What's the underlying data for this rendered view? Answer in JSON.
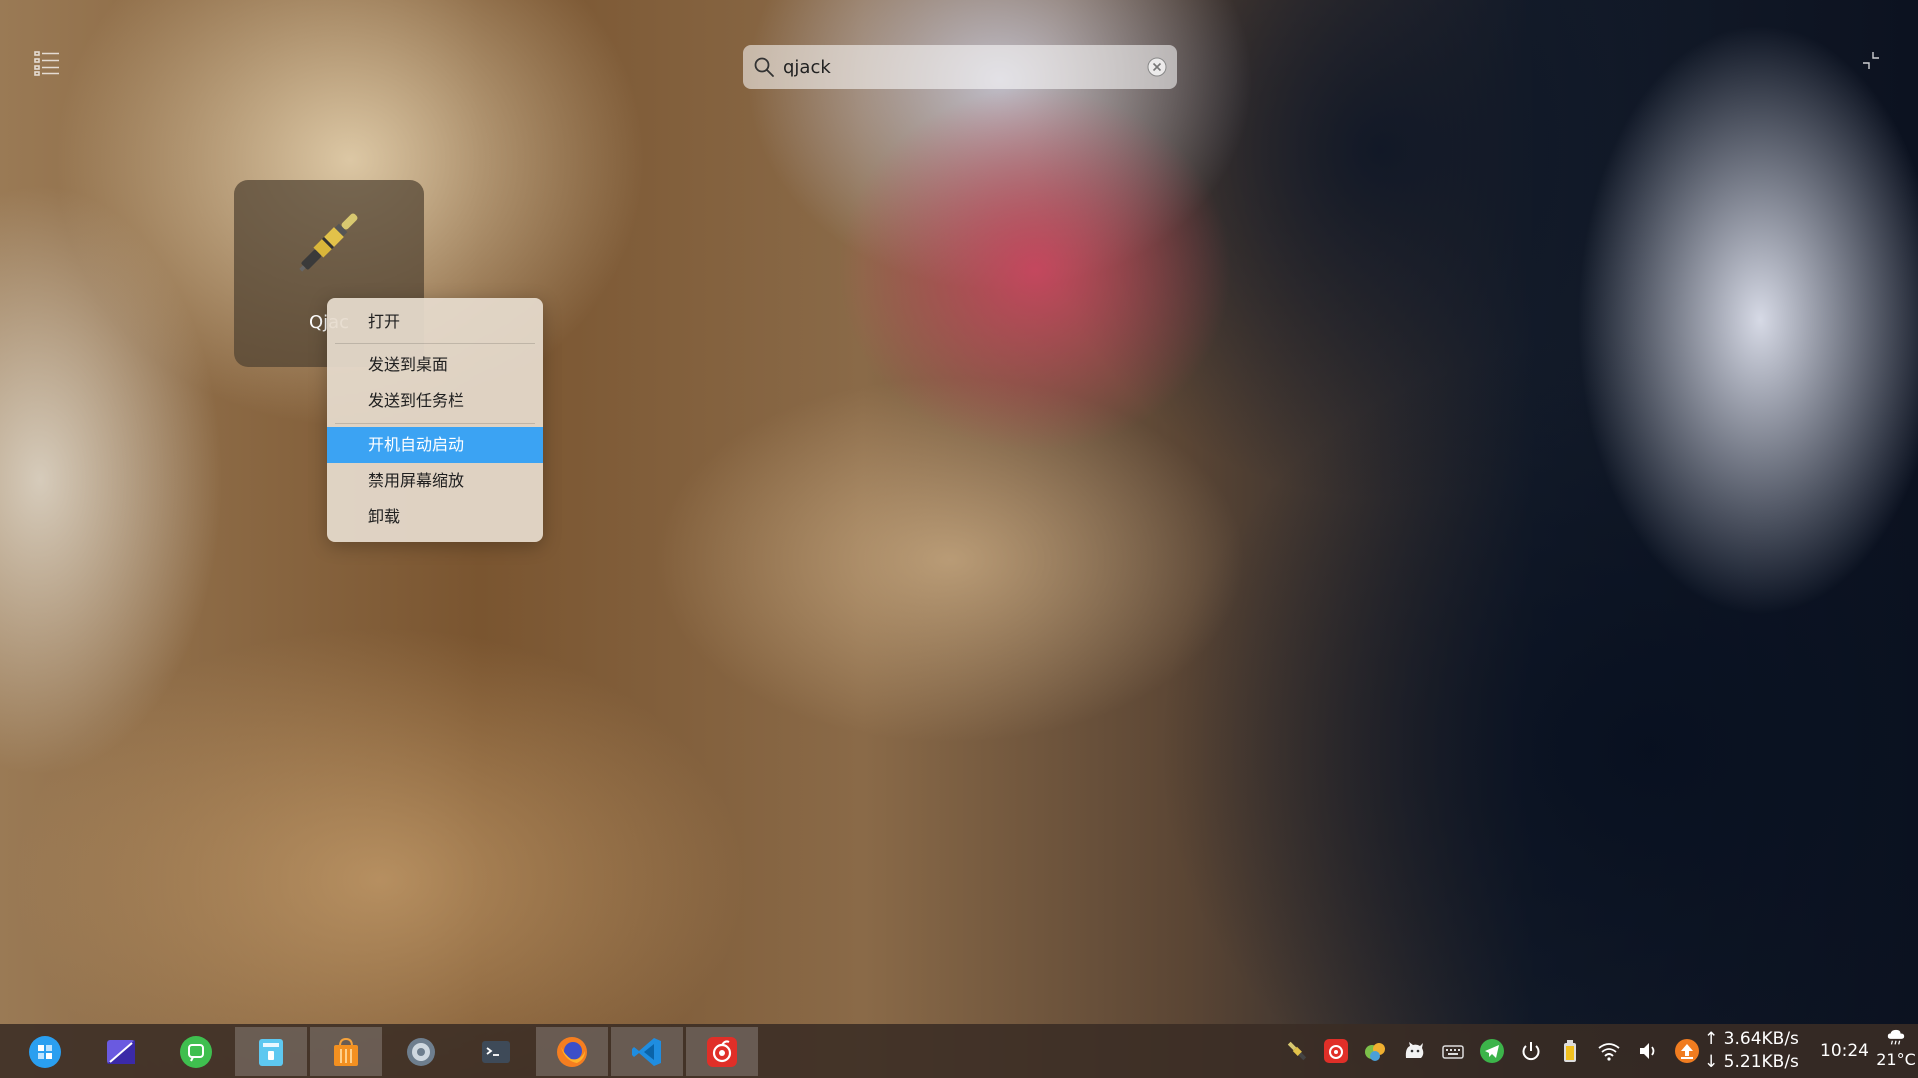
{
  "search": {
    "value": "qjack"
  },
  "result": {
    "label": "Qjac",
    "icon": "audio-jack-icon"
  },
  "context_menu": {
    "items": [
      {
        "label": "打开"
      },
      {
        "label": "发送到桌面"
      },
      {
        "label": "发送到任务栏"
      },
      {
        "label": "开机自动启动",
        "highlighted": true
      },
      {
        "label": "禁用屏幕缩放"
      },
      {
        "label": "卸载"
      }
    ],
    "highlight_color": "#3ba3f3"
  },
  "taskbar": {
    "apps": [
      {
        "icon": "launcher-icon",
        "active": false
      },
      {
        "icon": "screenshot-app-icon",
        "active": false
      },
      {
        "icon": "wechat-icon",
        "active": false
      },
      {
        "icon": "file-manager-icon",
        "active": true
      },
      {
        "icon": "app-store-icon",
        "active": true
      },
      {
        "icon": "settings-icon",
        "active": false
      },
      {
        "icon": "terminal-icon",
        "active": false
      },
      {
        "icon": "firefox-icon",
        "active": true
      },
      {
        "icon": "vscode-icon",
        "active": true
      },
      {
        "icon": "netease-music-icon",
        "active": true
      }
    ],
    "tray": [
      "qjackctl-tray-icon",
      "netease-music-tray-icon",
      "plugin-tray-icon",
      "cat-tray-icon",
      "keyboard-icon",
      "telegram-icon",
      "power-icon",
      "battery-icon",
      "wifi-icon",
      "volume-icon",
      "update-icon"
    ],
    "upload_speed": "3.64KB/s",
    "download_speed": "5.21KB/s",
    "upload_arrow": "↑",
    "download_arrow": "↓",
    "clock": "10:24",
    "weather": "21°C"
  }
}
